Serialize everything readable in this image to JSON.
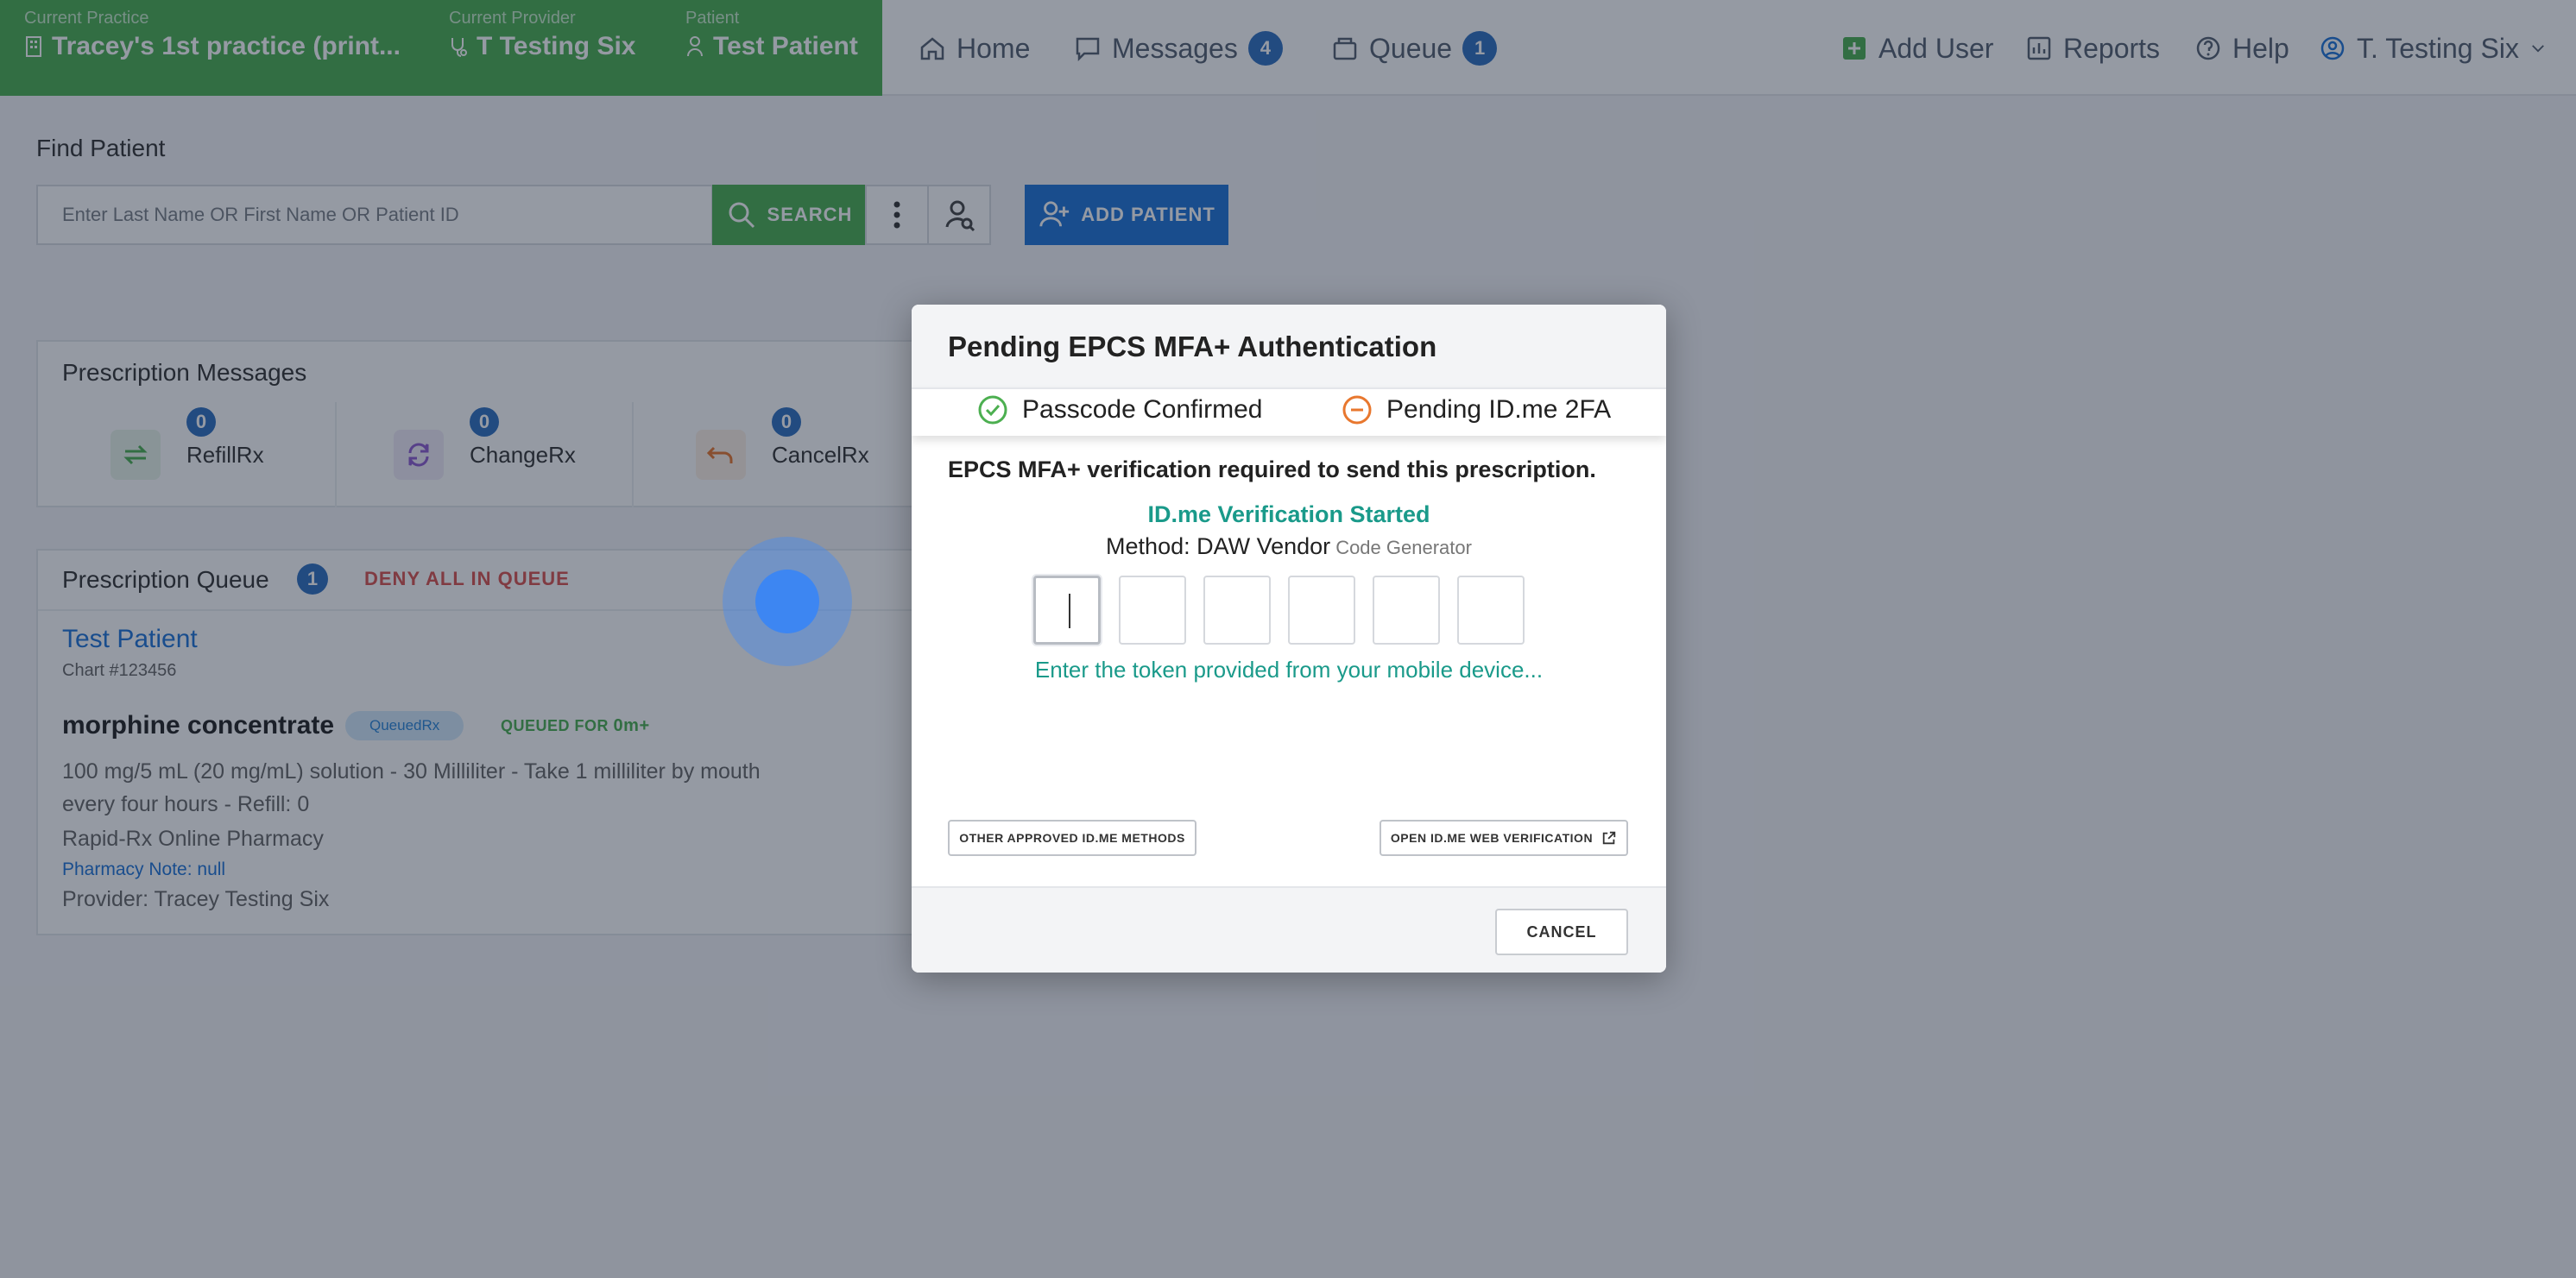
{
  "topbar": {
    "practice": {
      "label": "Current Practice",
      "value": "Tracey's 1st practice (print..."
    },
    "provider": {
      "label": "Current Provider",
      "value": "T Testing Six"
    },
    "patient": {
      "label": "Patient",
      "value": "Test Patient"
    },
    "nav": {
      "home": "Home",
      "messages": "Messages",
      "messages_count": "4",
      "queue": "Queue",
      "queue_count": "1",
      "add_user": "Add User",
      "reports": "Reports",
      "help": "Help",
      "user": "T. Testing Six"
    }
  },
  "find_patient": {
    "title": "Find Patient",
    "placeholder": "Enter Last Name OR First Name OR Patient ID",
    "search_label": "SEARCH",
    "add_patient_label": "ADD PATIENT"
  },
  "prescription_messages": {
    "title": "Prescription Messages",
    "tiles": [
      {
        "label": "RefillRx",
        "count": "0"
      },
      {
        "label": "ChangeRx",
        "count": "0"
      },
      {
        "label": "CancelRx",
        "count": "0"
      }
    ]
  },
  "prescription_queue": {
    "title": "Prescription Queue",
    "count": "1",
    "deny_all": "DENY ALL IN QUEUE",
    "patient_name": "Test Patient",
    "chart": "Chart #123456",
    "drug": "morphine concentrate",
    "status": "QueuedRx",
    "queued_for_label": "QUEUED FOR",
    "queued_for_value": "0m+",
    "sig_line1": "100 mg/5 mL (20 mg/mL) solution - 30 Milliliter - Take 1 milliliter by mouth",
    "sig_line2": "every four hours - Refill: 0",
    "pharmacy": "Rapid-Rx Online Pharmacy",
    "pharmacy_note": "Pharmacy Note: null",
    "provider": "Provider: Tracey Testing Six"
  },
  "modal": {
    "title": "Pending EPCS MFA+ Authentication",
    "step1": "Passcode Confirmed",
    "step2": "Pending ID.me 2FA",
    "required_text": "EPCS MFA+ verification required to send this prescription.",
    "started": "ID.me Verification Started",
    "method_label": "Method: DAW Vendor",
    "method_sub": "Code Generator",
    "token_hint": "Enter the token provided from your mobile device...",
    "other_methods": "OTHER APPROVED ID.ME METHODS",
    "open_web": "OPEN ID.ME WEB VERIFICATION",
    "cancel": "CANCEL"
  },
  "colors": {
    "practice_green": "#4caf50",
    "primary_blue": "#1e73d8",
    "teal_text": "#1a9a8a",
    "deny_red": "#d9534f",
    "pending_orange": "#e8772e"
  }
}
